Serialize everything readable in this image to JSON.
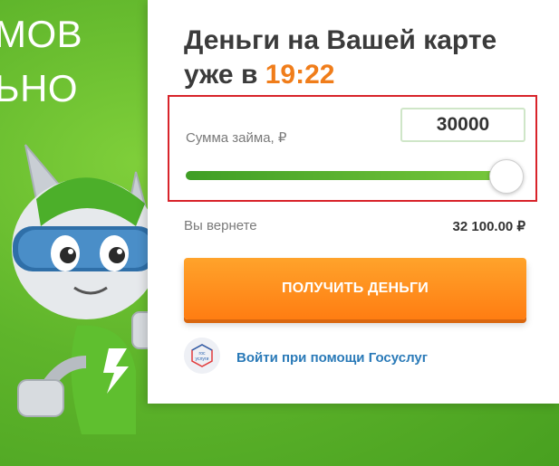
{
  "background": {
    "headline_line1": "МОВ",
    "headline_line2": "ЬНО",
    "mascot": "green-robot-mascot"
  },
  "card": {
    "title_prefix": "Деньги на Вашей карте уже в ",
    "title_time": "19:22",
    "amount_label": "Сумма займа, ₽",
    "amount_value": "30000",
    "slider_position": 1.0,
    "return_label": "Вы вернете",
    "return_value": "32 100.00 ₽",
    "cta_label": "ПОЛУЧИТЬ ДЕНЬГИ",
    "gosuslugi_icon_text_1": "гос",
    "gosuslugi_icon_text_2": "услуги",
    "gosuslugi_link": "Войти при помощи Госуслуг"
  },
  "colors": {
    "accent_orange": "#f07d1a",
    "brand_green": "#5fb52b",
    "highlight_red": "#d8232a",
    "link_blue": "#2a7ab8"
  }
}
